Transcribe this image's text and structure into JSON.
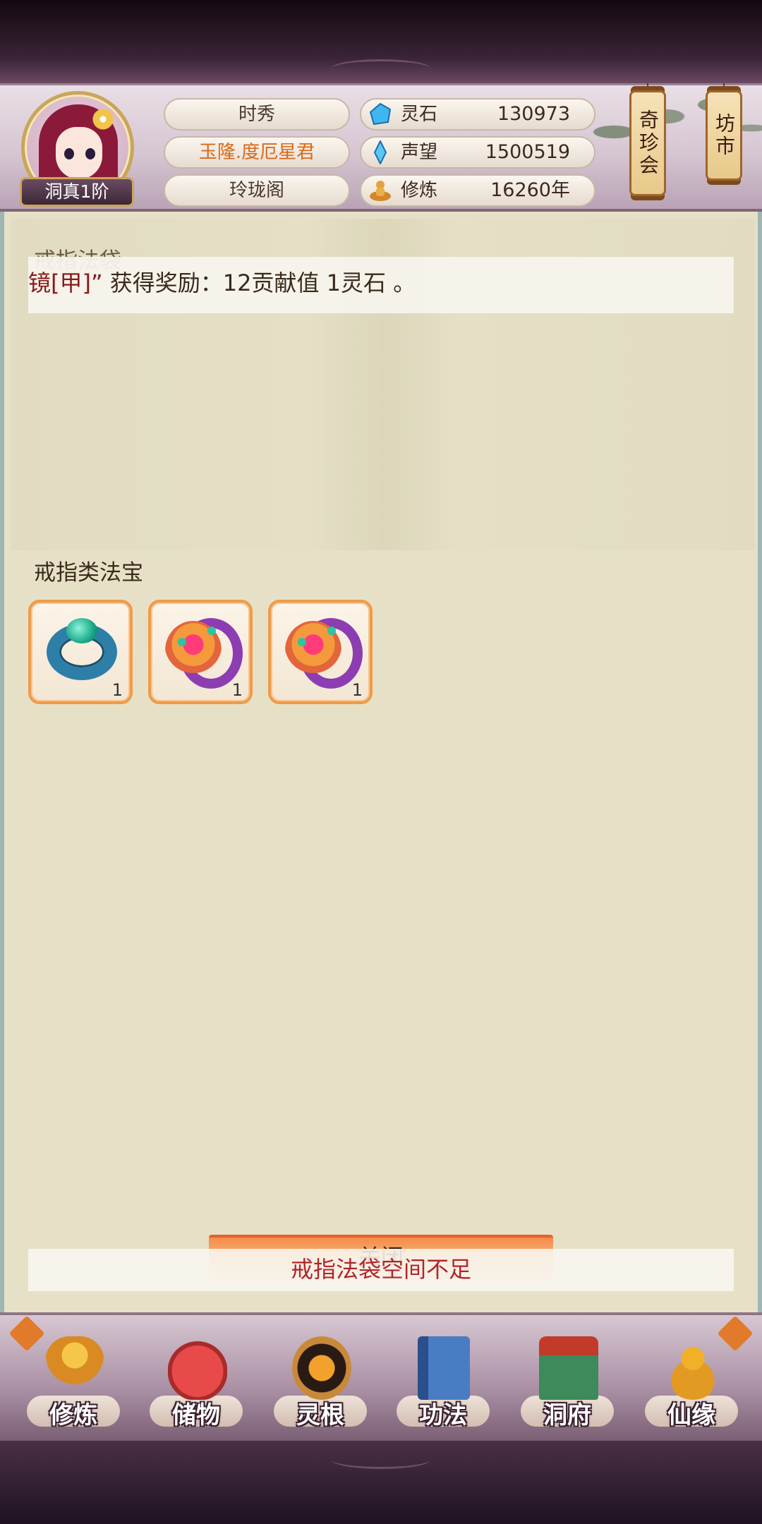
{
  "header": {
    "rank_badge": "洞真1阶",
    "name": "时秀",
    "title": "玉隆.度厄星君",
    "sect": "玲珑阁",
    "stats": [
      {
        "icon": "spirit-stone-icon",
        "label": "灵石",
        "value": "130973"
      },
      {
        "icon": "reputation-crystal-icon",
        "label": "声望",
        "value": "1500519"
      },
      {
        "icon": "cultivation-meditation-icon",
        "label": "修炼",
        "value": "16260年"
      }
    ],
    "lanterns": [
      {
        "label": "奇珍会"
      },
      {
        "label": "坊市"
      }
    ]
  },
  "main": {
    "bag_section_title": "戒指法袋",
    "notification": {
      "highlight": "镜[甲]”",
      "text": " 获得奖励：12贡献值 1灵石 。"
    },
    "treasure_section_title": "戒指类法宝",
    "items": [
      {
        "name": "blue-jade-ring",
        "quantity": "1",
        "color": "#2e7fa8"
      },
      {
        "name": "purple-fire-ring",
        "quantity": "1",
        "color": "#8c3db2"
      },
      {
        "name": "purple-fire-ring",
        "quantity": "1",
        "color": "#8c3db2"
      }
    ],
    "close_label": "关闭",
    "warning": "戒指法袋空间不足"
  },
  "nav": {
    "items": [
      {
        "label": "修炼",
        "icon": "monk-icon"
      },
      {
        "label": "储物",
        "icon": "storage-bag-icon"
      },
      {
        "label": "灵根",
        "icon": "spirit-root-icon"
      },
      {
        "label": "功法",
        "icon": "book-icon"
      },
      {
        "label": "洞府",
        "icon": "cave-palace-icon"
      },
      {
        "label": "仙缘",
        "icon": "gourd-icon"
      }
    ]
  },
  "colors": {
    "accent_orange": "#ef9b4b",
    "warning_red": "#b0262a",
    "title_orange": "#d86a1a"
  }
}
